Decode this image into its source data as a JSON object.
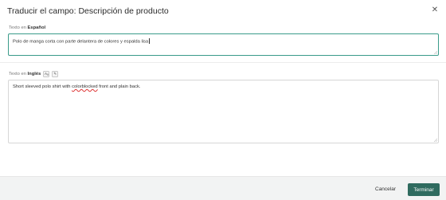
{
  "dialog": {
    "title": "Traducir el campo: Descripción de producto",
    "close_icon": "close-icon"
  },
  "source": {
    "label_prefix": "Texto en",
    "language": "Español",
    "value": "Polo de manga corta con parte delantera de colores y espalda lisa"
  },
  "target": {
    "label_prefix": "Texto en",
    "language": "Inglés",
    "translate_icon_glyph": "Aₐ",
    "translate_icon": "translate-icon",
    "settings_icon_glyph": "✎",
    "settings_icon": "auto-translate-icon",
    "value_before": "Short sleeved polo shirt with ",
    "value_misspelled": "colorblocked",
    "value_after": " front and plain back."
  },
  "footer": {
    "cancel_label": "Cancelar",
    "finish_label": "Terminar"
  },
  "colors": {
    "accent": "#2f6b5f",
    "focus_border": "#3a9b8a"
  }
}
